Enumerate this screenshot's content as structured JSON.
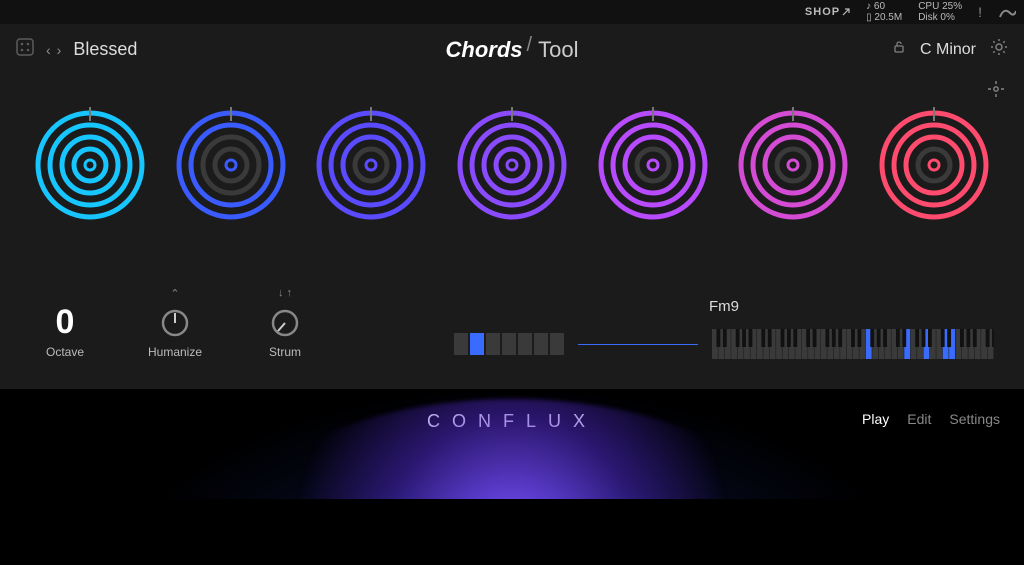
{
  "statusbar": {
    "shop": "SHOP",
    "tempo_bpm": "60",
    "tempo_mem": "20.5M",
    "cpu_label": "CPU",
    "cpu_value": "25%",
    "disk_label": "Disk",
    "disk_value": "0%"
  },
  "header": {
    "preset_name": "Blessed",
    "prev": "‹",
    "next": "›",
    "app_left": "Chords",
    "app_right": "Tool",
    "key_scale": "C Minor"
  },
  "chord_circles": [
    {
      "color": "#18c6ff",
      "rings_on": [
        1,
        1,
        1,
        1
      ]
    },
    {
      "color": "#3a5cff",
      "rings_on": [
        1,
        1,
        0,
        0
      ]
    },
    {
      "color": "#5a4bff",
      "rings_on": [
        1,
        1,
        1,
        0
      ]
    },
    {
      "color": "#8a4bff",
      "rings_on": [
        1,
        1,
        1,
        1
      ]
    },
    {
      "color": "#b94bff",
      "rings_on": [
        1,
        1,
        1,
        0
      ]
    },
    {
      "color": "#d44bd4",
      "rings_on": [
        1,
        1,
        1,
        0
      ]
    },
    {
      "color": "#ff4b6e",
      "rings_on": [
        1,
        1,
        1,
        0
      ]
    }
  ],
  "controls": {
    "octave_value": "0",
    "octave_label": "Octave",
    "humanize_label": "Humanize",
    "humanize_top": "⌃",
    "strum_label": "Strum",
    "strum_top": "↓ ↑"
  },
  "chord_display": {
    "chord_name": "Fm9",
    "degree_count": 7,
    "degree_active_index": 1,
    "keyboard_highlight_color": "#3a6bff",
    "highlighted_keys": [
      24,
      30,
      33,
      36,
      37
    ]
  },
  "footer": {
    "brand": "CONFLUX",
    "tabs": [
      {
        "label": "Play",
        "active": true
      },
      {
        "label": "Edit",
        "active": false
      },
      {
        "label": "Settings",
        "active": false
      }
    ]
  }
}
